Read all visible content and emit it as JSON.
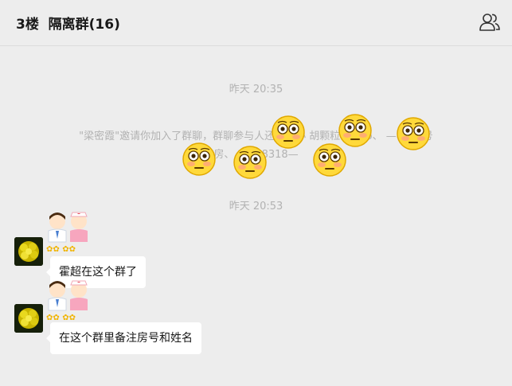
{
  "header": {
    "title": "3楼  隔离群(16)",
    "members_icon": "people-icon"
  },
  "messages": {
    "time1": "昨天 20:35",
    "system_line1": "\"梁密霞\"邀请你加入了群聊，群聊参与人还有：小 胡颗粒、 Luo、 —8313号",
    "system_line2": "房、 实 、8318—",
    "time2": "昨天 20:53",
    "msg1_text": "霍超在这个群了",
    "msg2_text": "在这个群里备注房号和姓名"
  },
  "icons": {
    "emoji": "flushed-face-emoji",
    "avatar": "yellow-flower-avatar",
    "badges": "doctor-and-nurse-sticker"
  },
  "colors": {
    "background": "#ededed",
    "bubble": "#ffffff",
    "system_text": "#b2b2b2",
    "title_text": "#191919"
  }
}
